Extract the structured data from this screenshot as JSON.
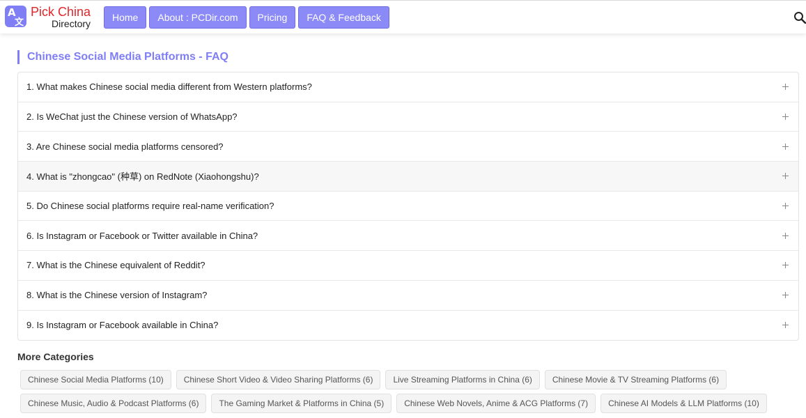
{
  "brand": {
    "name_part1": "Pick ",
    "name_part2": "China",
    "subtitle": "Directory",
    "logo_glyph1": "A",
    "logo_glyph2": "文"
  },
  "nav": {
    "items": [
      {
        "label": "Home"
      },
      {
        "label": "About : PCDir.com"
      },
      {
        "label": "Pricing"
      },
      {
        "label": "FAQ & Feedback"
      }
    ]
  },
  "icons": {
    "search": "search-icon",
    "expand": "plus-icon"
  },
  "colors": {
    "accent": "#7f7ef5",
    "nav_button": "#8b8af7",
    "brand_red": "#e5252a"
  },
  "faq": {
    "title": "Chinese Social Media Platforms - FAQ",
    "items": [
      {
        "q": "1. What makes Chinese social media different from Western platforms?"
      },
      {
        "q": "2. Is WeChat just the Chinese version of WhatsApp?"
      },
      {
        "q": "3. Are Chinese social media platforms censored?"
      },
      {
        "q": "4. What is \"zhongcao\" (种草) on RedNote (Xiaohongshu)?"
      },
      {
        "q": "5. Do Chinese social platforms require real-name verification?"
      },
      {
        "q": "6. Is Instagram or Facebook or Twitter available in China?"
      },
      {
        "q": "7. What is the Chinese equivalent of Reddit?"
      },
      {
        "q": "8. What is the Chinese version of Instagram?"
      },
      {
        "q": "9. Is Instagram or Facebook available in China?"
      }
    ]
  },
  "more_categories": {
    "title": "More Categories",
    "tags": [
      {
        "label": "Chinese Social Media Platforms (10)"
      },
      {
        "label": "Chinese Short Video & Video Sharing Platforms (6)"
      },
      {
        "label": "Live Streaming Platforms in China (6)"
      },
      {
        "label": "Chinese Movie & TV Streaming Platforms (6)"
      },
      {
        "label": "Chinese Music, Audio & Podcast Platforms (6)"
      },
      {
        "label": "The Gaming Market & Platforms in China (5)"
      },
      {
        "label": "Chinese Web Novels, Anime & ACG Platforms (7)"
      },
      {
        "label": "Chinese AI Models & LLM Platforms (10)"
      }
    ]
  }
}
